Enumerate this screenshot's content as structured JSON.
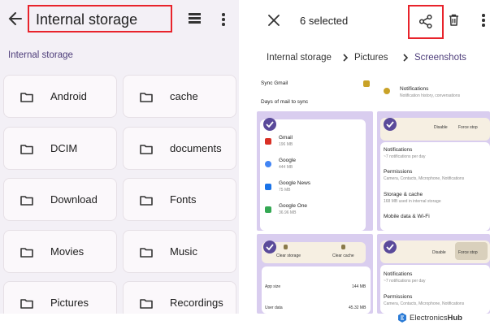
{
  "left": {
    "title": "Internal storage",
    "breadcrumb": "Internal storage",
    "folders": [
      "Android",
      "cache",
      "DCIM",
      "documents",
      "Download",
      "Fonts",
      "Movies",
      "Music",
      "Pictures",
      "Recordings"
    ]
  },
  "right": {
    "selected_count_label": "6 selected",
    "breadcrumbs": [
      "Internal storage",
      "Pictures",
      "Screenshots"
    ],
    "shots": {
      "s1": {
        "row1": "Sync Gmail",
        "row2": "Days of mail to sync"
      },
      "s2": {
        "title": "Notifications",
        "sub": "Notification history, conversations"
      },
      "s3": {
        "apps": [
          {
            "name": "Gmail",
            "size": "196 MB"
          },
          {
            "name": "Google",
            "size": "444 MB"
          },
          {
            "name": "Google News",
            "size": "75 MB"
          },
          {
            "name": "Google One",
            "size": "36.96 MB"
          }
        ]
      },
      "s4": {
        "btn1": "Disable",
        "btn2": "Force stop",
        "items": [
          {
            "title": "Notifications",
            "sub": "~7 notifications per day"
          },
          {
            "title": "Permissions",
            "sub": "Camera, Contacts, Microphone, Notifications"
          },
          {
            "title": "Storage & cache",
            "sub": "168 MB used in internal storage"
          },
          {
            "title": "Mobile data & Wi-Fi",
            "sub": ""
          }
        ]
      },
      "s5": {
        "btn1": "Clear storage",
        "btn2": "Clear cache",
        "row1_label": "App size",
        "row1_value": "144 MB",
        "row2_label": "User data",
        "row2_value": "45.32 MB"
      },
      "s6": {
        "btn1": "Disable",
        "btn2": "Force stop",
        "items": [
          {
            "title": "Notifications",
            "sub": "~7 notifications per day"
          },
          {
            "title": "Permissions",
            "sub": "Camera, Contacts, Microphone, Notifications"
          }
        ]
      }
    }
  },
  "watermark": {
    "brand_a": "Electronics",
    "brand_b": "Hub"
  },
  "colors": {
    "highlight": "#e8232b",
    "accent": "#5a4a9a",
    "panel_bg": "#f3f0f6"
  }
}
